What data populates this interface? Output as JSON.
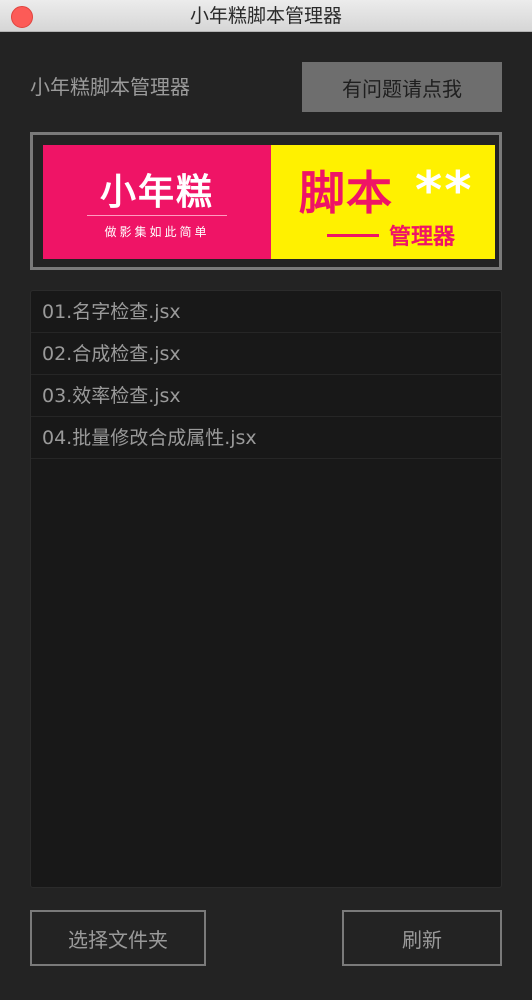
{
  "window": {
    "title": "小年糕脚本管理器"
  },
  "header": {
    "app_title": "小年糕脚本管理器",
    "help_button_label": "有问题请点我"
  },
  "banner": {
    "left_title": "小年糕",
    "left_subtitle": "做影集如此简单",
    "right_title": "脚本",
    "right_stars": "**",
    "right_subtitle": "管理器",
    "colors": {
      "pink": "#ef1466",
      "yellow": "#fff100"
    }
  },
  "scripts": [
    {
      "label": "01.名字检查.jsx"
    },
    {
      "label": "02.合成检查.jsx"
    },
    {
      "label": "03.效率检查.jsx"
    },
    {
      "label": "04.批量修改合成属性.jsx"
    }
  ],
  "footer": {
    "choose_folder_label": "选择文件夹",
    "refresh_label": "刷新"
  },
  "icons": {
    "close": "close-traffic-light-icon"
  }
}
